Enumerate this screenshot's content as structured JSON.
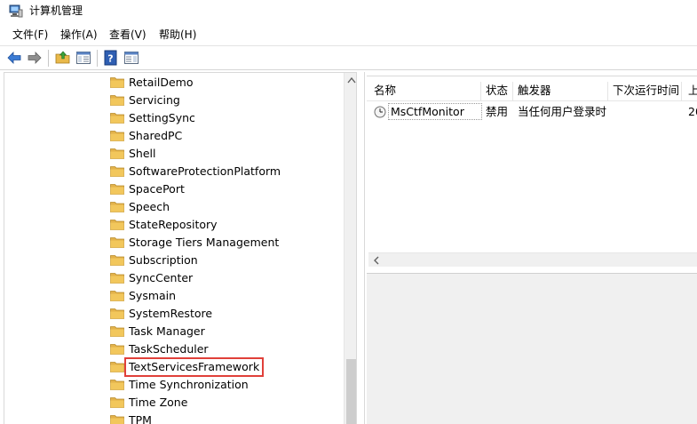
{
  "window": {
    "title": "计算机管理"
  },
  "menu": [
    {
      "label": "文件(F)"
    },
    {
      "label": "操作(A)"
    },
    {
      "label": "查看(V)"
    },
    {
      "label": "帮助(H)"
    }
  ],
  "toolbar": {
    "icons": [
      "back-arrow-icon",
      "forward-arrow-icon",
      "up-folder-icon",
      "show-hide-tree-icon",
      "help-icon",
      "action-pane-icon"
    ]
  },
  "tree": {
    "items": [
      "RetailDemo",
      "Servicing",
      "SettingSync",
      "SharedPC",
      "Shell",
      "SoftwareProtectionPlatform",
      "SpacePort",
      "Speech",
      "StateRepository",
      "Storage Tiers Management",
      "Subscription",
      "SyncCenter",
      "Sysmain",
      "SystemRestore",
      "Task Manager",
      "TaskScheduler",
      "TextServicesFramework",
      "Time Synchronization",
      "Time Zone",
      "TPM"
    ],
    "selected_index": 16
  },
  "task_list": {
    "columns": [
      "名称",
      "状态",
      "触发器",
      "下次运行时间",
      "上"
    ],
    "rows": [
      {
        "name": "MsCtfMonitor",
        "status": "禁用",
        "trigger": "当任何用户登录时",
        "next_run": "",
        "last_run": "20"
      }
    ]
  },
  "colors": {
    "selection_outline": "#e0403a",
    "folder": "#f2c75c",
    "toolbar_arrow": "#3a7bd5"
  }
}
